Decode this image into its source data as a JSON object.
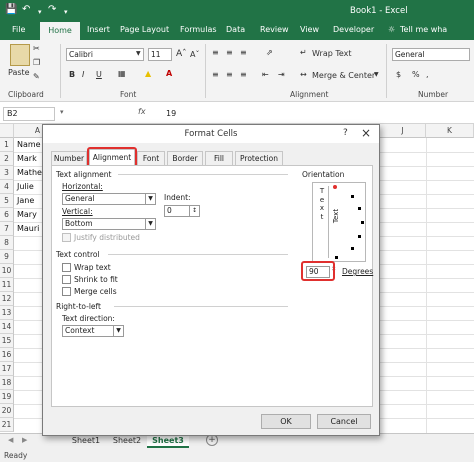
{
  "titlebar": {
    "quick_access": [
      "save-icon",
      "undo-icon",
      "redo-icon"
    ],
    "title": "Book1 - Excel"
  },
  "menu": {
    "tabs": [
      "File",
      "Home",
      "Insert",
      "Page Layout",
      "Formulas",
      "Data",
      "Review",
      "View",
      "Developer"
    ],
    "tell_me": "Tell me wha"
  },
  "ribbon": {
    "clipboard": {
      "paste": "Paste",
      "label": "Clipboard"
    },
    "font": {
      "name": "Calibri",
      "size": "11",
      "bold": "B",
      "italic": "I",
      "underline": "U",
      "label": "Font"
    },
    "alignment": {
      "wrap_text": "Wrap Text",
      "merge_center": "Merge & Center",
      "label": "Alignment"
    },
    "number": {
      "format": "General",
      "label": "Number"
    }
  },
  "formula_bar": {
    "cell_ref": "B2",
    "fx": "fx",
    "value": "19"
  },
  "sheet": {
    "columns": [
      "A",
      "J",
      "K"
    ],
    "rows": [
      "1",
      "2",
      "3",
      "4",
      "5",
      "6",
      "7",
      "8",
      "9",
      "10",
      "11",
      "12",
      "13",
      "14",
      "15",
      "16",
      "17",
      "18",
      "19",
      "20",
      "21"
    ],
    "col_a": [
      "Name",
      "Mark",
      "Mathe",
      "Julie",
      "Jane",
      "Mary",
      "Mauri"
    ]
  },
  "sheet_tabs": [
    "Sheet1",
    "Sheet2",
    "Sheet3"
  ],
  "status": "Ready",
  "dialog": {
    "title": "Format Cells",
    "help": "?",
    "close": "×",
    "tabs": [
      "Number",
      "Alignment",
      "Font",
      "Border",
      "Fill",
      "Protection"
    ],
    "text_alignment": {
      "heading": "Text alignment",
      "horizontal_label": "Horizontal:",
      "horizontal_value": "General",
      "indent_label": "Indent:",
      "indent_value": "0",
      "vertical_label": "Vertical:",
      "vertical_value": "Bottom",
      "justify": "Justify distributed"
    },
    "text_control": {
      "heading": "Text control",
      "wrap": "Wrap text",
      "shrink": "Shrink to fit",
      "merge": "Merge cells"
    },
    "rtl": {
      "heading": "Right-to-left",
      "direction_label": "Text direction:",
      "direction_value": "Context"
    },
    "orientation": {
      "heading": "Orientation",
      "vertical_text": "T e x t",
      "rotated_text": "Text",
      "degrees_value": "90",
      "degrees_label": "Degrees"
    },
    "ok": "OK",
    "cancel": "Cancel"
  },
  "colors": {
    "excel_green": "#217346",
    "highlight_red": "#e0302e"
  }
}
